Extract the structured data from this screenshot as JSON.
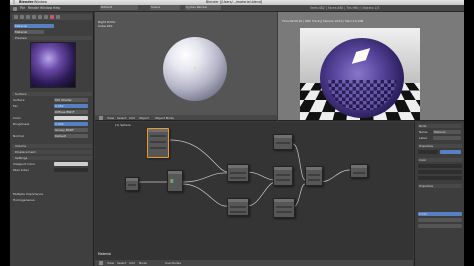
{
  "menubar": {
    "apple": "",
    "app": "Blender",
    "window": "Window",
    "title": "Blender [/Users/.../material.blend]"
  },
  "info": {
    "menus": [
      "File",
      "Render",
      "Window",
      "Help"
    ],
    "layout": "Default",
    "scene": "Scene",
    "engine": "Cycles Render",
    "stats": "Verts:482 | Faces:480 | Tris:960 | Objects:1/3"
  },
  "props": {
    "preview_label": "Preview",
    "sections": [
      "Surface",
      "Volume",
      "Displacement",
      "Settings"
    ],
    "surface_field": "Use Nodes",
    "shader_value": "Mix Shader",
    "fac_label": "Fac",
    "fac_value": "0.050",
    "shader1": "Diffuse BSDF",
    "shader2": "Glossy BSDF",
    "color_label": "Color",
    "roughness_label": "Roughness",
    "roughness_value": "0.000",
    "normal_label": "Normal",
    "normal_value": "Default",
    "viewport_color_label": "Viewport Color",
    "pass_index_label": "Pass Index",
    "multiple_importance": "Multiple Importance",
    "homogeneous": "Homogeneous"
  },
  "viewport": {
    "view_label": "Right Ortho",
    "sub_label": "Cube.010",
    "menus": [
      "View",
      "Select",
      "Add",
      "Object"
    ],
    "mode": "Object Mode"
  },
  "render": {
    "stats": "Time:00:00.45 | Path Tracing Sample 10/10 | Mem:14.44M"
  },
  "nodeeditor": {
    "menus": [
      "View",
      "Select",
      "Add",
      "Node"
    ],
    "material": "Material",
    "use_nodes": "Use Nodes",
    "zoom_label": "(1) Sphere"
  },
  "nodeside": {
    "name_label": "Name:",
    "name_value": "Material",
    "label_label": "Label:",
    "items": [
      "Node",
      "Properties",
      "Color",
      "Properties"
    ],
    "value": "0.050"
  }
}
